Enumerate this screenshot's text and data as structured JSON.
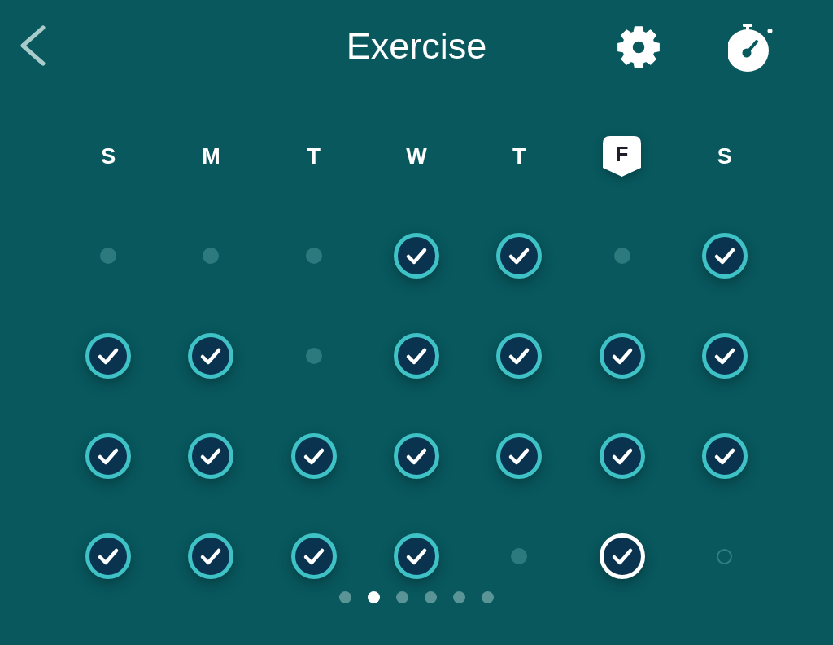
{
  "header": {
    "title": "Exercise"
  },
  "days": [
    {
      "label": "S",
      "selected": false
    },
    {
      "label": "M",
      "selected": false
    },
    {
      "label": "T",
      "selected": false
    },
    {
      "label": "W",
      "selected": false
    },
    {
      "label": "T",
      "selected": false
    },
    {
      "label": "F",
      "selected": true
    },
    {
      "label": "S",
      "selected": false
    }
  ],
  "weeks": [
    {
      "cells": [
        {
          "kind": "rest",
          "today": false
        },
        {
          "kind": "rest",
          "today": false
        },
        {
          "kind": "rest",
          "today": false
        },
        {
          "kind": "done",
          "today": false
        },
        {
          "kind": "done",
          "today": false
        },
        {
          "kind": "rest",
          "today": false
        },
        {
          "kind": "done",
          "today": false
        }
      ]
    },
    {
      "cells": [
        {
          "kind": "done",
          "today": false
        },
        {
          "kind": "done",
          "today": false
        },
        {
          "kind": "rest",
          "today": false
        },
        {
          "kind": "done",
          "today": false
        },
        {
          "kind": "done",
          "today": false
        },
        {
          "kind": "done",
          "today": false
        },
        {
          "kind": "done",
          "today": false
        }
      ]
    },
    {
      "cells": [
        {
          "kind": "done",
          "today": false
        },
        {
          "kind": "done",
          "today": false
        },
        {
          "kind": "done",
          "today": false
        },
        {
          "kind": "done",
          "today": false
        },
        {
          "kind": "done",
          "today": false
        },
        {
          "kind": "done",
          "today": false
        },
        {
          "kind": "done",
          "today": false
        }
      ]
    },
    {
      "cells": [
        {
          "kind": "done",
          "today": false
        },
        {
          "kind": "done",
          "today": false
        },
        {
          "kind": "done",
          "today": false
        },
        {
          "kind": "done",
          "today": false
        },
        {
          "kind": "rest",
          "today": false
        },
        {
          "kind": "done",
          "today": true
        },
        {
          "kind": "upcoming",
          "today": false
        }
      ]
    }
  ],
  "pages": [
    {
      "selected": false
    },
    {
      "selected": true
    },
    {
      "selected": false
    },
    {
      "selected": false
    },
    {
      "selected": false
    },
    {
      "selected": false
    }
  ]
}
